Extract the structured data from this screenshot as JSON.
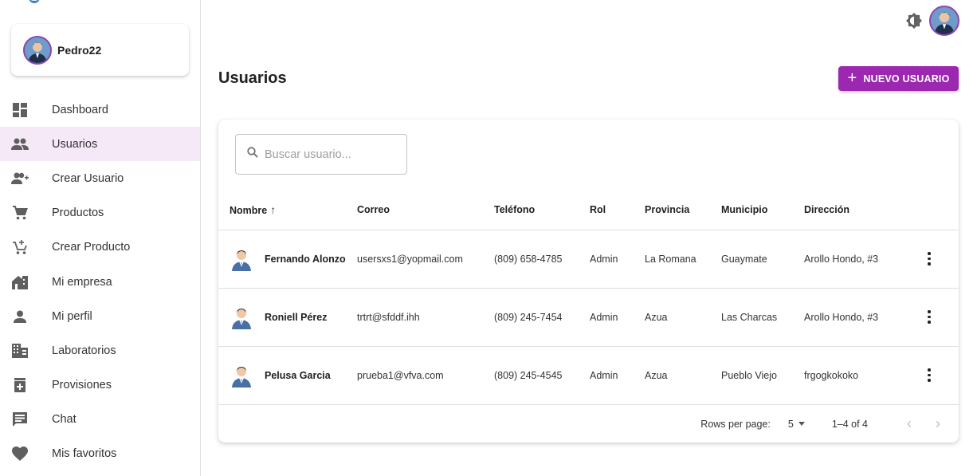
{
  "sidebar": {
    "profile": {
      "username": "Pedro22"
    },
    "items": [
      {
        "label": "Dashboard",
        "icon": "dashboard-icon",
        "active": false
      },
      {
        "label": "Usuarios",
        "icon": "people-icon",
        "active": true
      },
      {
        "label": "Crear Usuario",
        "icon": "add-user-icon",
        "active": false
      },
      {
        "label": "Productos",
        "icon": "cart-icon",
        "active": false
      },
      {
        "label": "Crear Producto",
        "icon": "add-cart-icon",
        "active": false
      },
      {
        "label": "Mi empresa",
        "icon": "store-icon",
        "active": false
      },
      {
        "label": "Mi perfil",
        "icon": "person-icon",
        "active": false
      },
      {
        "label": "Laboratorios",
        "icon": "building-icon",
        "active": false
      },
      {
        "label": "Provisiones",
        "icon": "medical-box-icon",
        "active": false
      },
      {
        "label": "Chat",
        "icon": "chat-icon",
        "active": false
      },
      {
        "label": "Mis favoritos",
        "icon": "heart-icon",
        "active": false
      }
    ]
  },
  "main": {
    "title": "Usuarios",
    "new_user_label": "NUEVO USUARIO",
    "search": {
      "placeholder": "Buscar usuario...",
      "value": ""
    },
    "table": {
      "columns": [
        "Nombre",
        "Correo",
        "Teléfono",
        "Rol",
        "Provincia",
        "Municipio",
        "Dirección"
      ],
      "sort": {
        "column": "Nombre",
        "direction": "asc"
      },
      "rows": [
        {
          "name": "Fernando Alonzo",
          "email": "usersxs1@yopmail.com",
          "phone": "(809) 658-4785",
          "role": "Admin",
          "province": "La Romana",
          "municipality": "Guaymate",
          "address": "Arollo Hondo, #3"
        },
        {
          "name": "Roniell Pérez",
          "email": "trtrt@sfddf.ihh",
          "phone": "(809) 245-7454",
          "role": "Admin",
          "province": "Azua",
          "municipality": "Las Charcas",
          "address": "Arollo Hondo, #3"
        },
        {
          "name": "Pelusa Garcia",
          "email": "prueba1@vfva.com",
          "phone": "(809) 245-4545",
          "role": "Admin",
          "province": "Azua",
          "municipality": "Pueblo Viejo",
          "address": "frgogkokoko"
        }
      ]
    },
    "pagination": {
      "rows_per_page_label": "Rows per page:",
      "rows_per_page": "5",
      "range": "1–4 of 4"
    }
  },
  "colors": {
    "accent": "#9c27b0",
    "active_nav_bg": "#f5e9f8"
  }
}
